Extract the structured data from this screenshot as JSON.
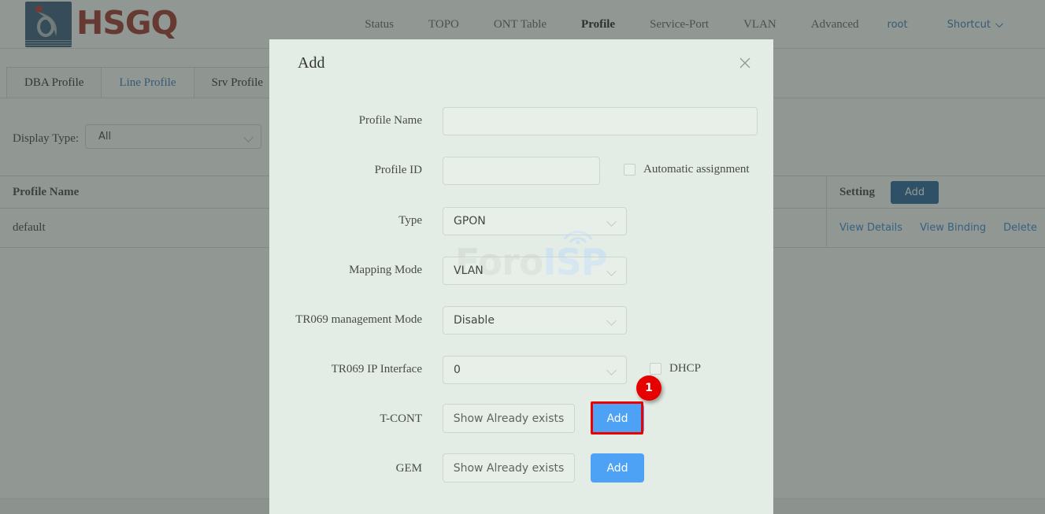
{
  "header": {
    "logo_text": "HSGQ",
    "nav": [
      {
        "label": "Status",
        "state": "normal"
      },
      {
        "label": "TOPO",
        "state": "normal"
      },
      {
        "label": "ONT Table",
        "state": "normal"
      },
      {
        "label": "Profile",
        "state": "active"
      },
      {
        "label": "Service-Port",
        "state": "normal"
      },
      {
        "label": "VLAN",
        "state": "normal"
      },
      {
        "label": "Advanced",
        "state": "normal"
      }
    ],
    "user": "root",
    "shortcut": "Shortcut"
  },
  "tabs": [
    {
      "label": "DBA Profile",
      "active": false
    },
    {
      "label": "Line Profile",
      "active": true
    },
    {
      "label": "Srv Profile",
      "active": false
    }
  ],
  "filter": {
    "label": "Display Type:",
    "value": "All"
  },
  "table": {
    "columns": [
      "Profile Name",
      "Setting"
    ],
    "add_button": "Add",
    "rows": [
      {
        "profile_name": "default",
        "actions": [
          "View Details",
          "View Binding",
          "Delete"
        ]
      }
    ]
  },
  "watermark": {
    "part1": "Foro",
    "part2": "ISP"
  },
  "modal": {
    "title": "Add",
    "close_label": "×",
    "fields": {
      "profile_name": {
        "label": "Profile Name",
        "value": "",
        "placeholder": ""
      },
      "profile_id": {
        "label": "Profile ID",
        "value": "",
        "placeholder": ""
      },
      "automatic_assignment": {
        "label": "Automatic assignment",
        "checked": false
      },
      "type": {
        "label": "Type",
        "value": "GPON"
      },
      "mapping_mode": {
        "label": "Mapping Mode",
        "value": "VLAN"
      },
      "tr069_management_mode": {
        "label": "TR069 management Mode",
        "value": "Disable"
      },
      "tr069_ip_interface": {
        "label": "TR069 IP Interface",
        "value": "0"
      },
      "dhcp": {
        "label": "DHCP",
        "checked": false
      },
      "tcont": {
        "label": "T-CONT",
        "show_button": "Show Already exists",
        "add_button": "Add"
      },
      "gem": {
        "label": "GEM",
        "show_button": "Show Already exists",
        "add_button": "Add"
      }
    },
    "highlight": {
      "step_number": "1",
      "target": "tcont-add-button",
      "color": "#e60000"
    }
  },
  "colors": {
    "brand_red": "#9c2520",
    "logo_blue": "#2d5377",
    "link_blue": "#2f7fd0",
    "accent_blue": "#4da2f5",
    "table_add_blue": "#1c5b96",
    "modal_bg": "#e3ece5",
    "highlight_red": "#e60000"
  }
}
